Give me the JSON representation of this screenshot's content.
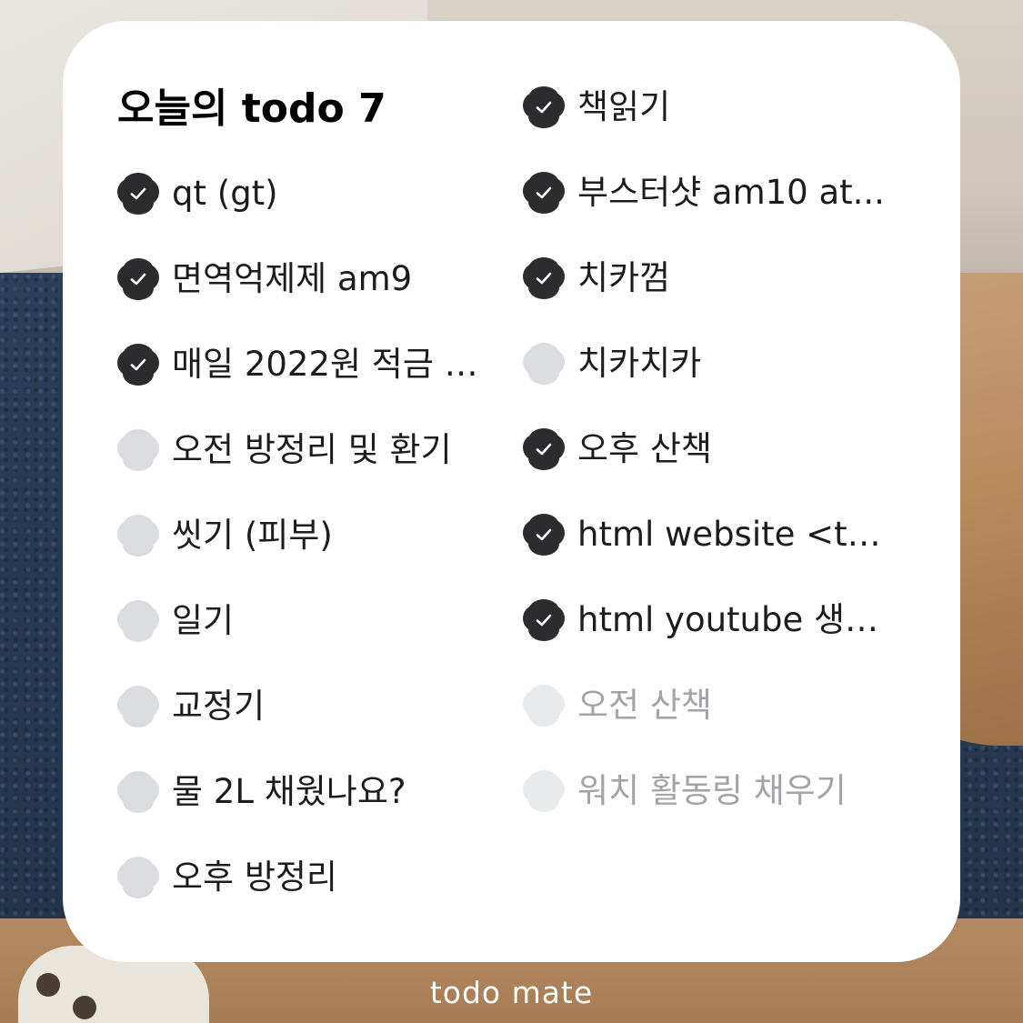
{
  "widget": {
    "title": "오늘의 todo 7",
    "footer": "todo mate"
  },
  "left_column": [
    {
      "label": "qt (gt)",
      "state": "done"
    },
    {
      "label": "면역억제제 am9",
      "state": "done"
    },
    {
      "label": "매일 2022원 적금 (…",
      "state": "done"
    },
    {
      "label": "오전 방정리 및 환기",
      "state": "todo"
    },
    {
      "label": "씻기 (피부)",
      "state": "todo"
    },
    {
      "label": "일기",
      "state": "todo"
    },
    {
      "label": "교정기",
      "state": "todo"
    },
    {
      "label": "물 2L 채웠나요?",
      "state": "todo"
    },
    {
      "label": "오후 방정리",
      "state": "todo"
    }
  ],
  "right_column": [
    {
      "label": "책읽기",
      "state": "done"
    },
    {
      "label": "부스터샷 am10 at...",
      "state": "done"
    },
    {
      "label": "치카껌",
      "state": "done"
    },
    {
      "label": "치카치카",
      "state": "todo"
    },
    {
      "label": "오후 산책",
      "state": "done"
    },
    {
      "label": "html website <tag...",
      "state": "done"
    },
    {
      "label": "html youtube 생활…",
      "state": "done"
    },
    {
      "label": "오전 산책",
      "state": "faded"
    },
    {
      "label": "워치 활동링 채우기",
      "state": "faded"
    }
  ],
  "colors": {
    "check_done": "#2c2c2e",
    "check_todo": "#dcdde0",
    "check_faded": "#e9eaec",
    "text": "#1c1c1e",
    "text_faded": "#a3a3a8",
    "widget_bg": "#ffffff"
  },
  "icons": {
    "done": "checkmark-flower-icon",
    "todo": "empty-flower-icon"
  }
}
